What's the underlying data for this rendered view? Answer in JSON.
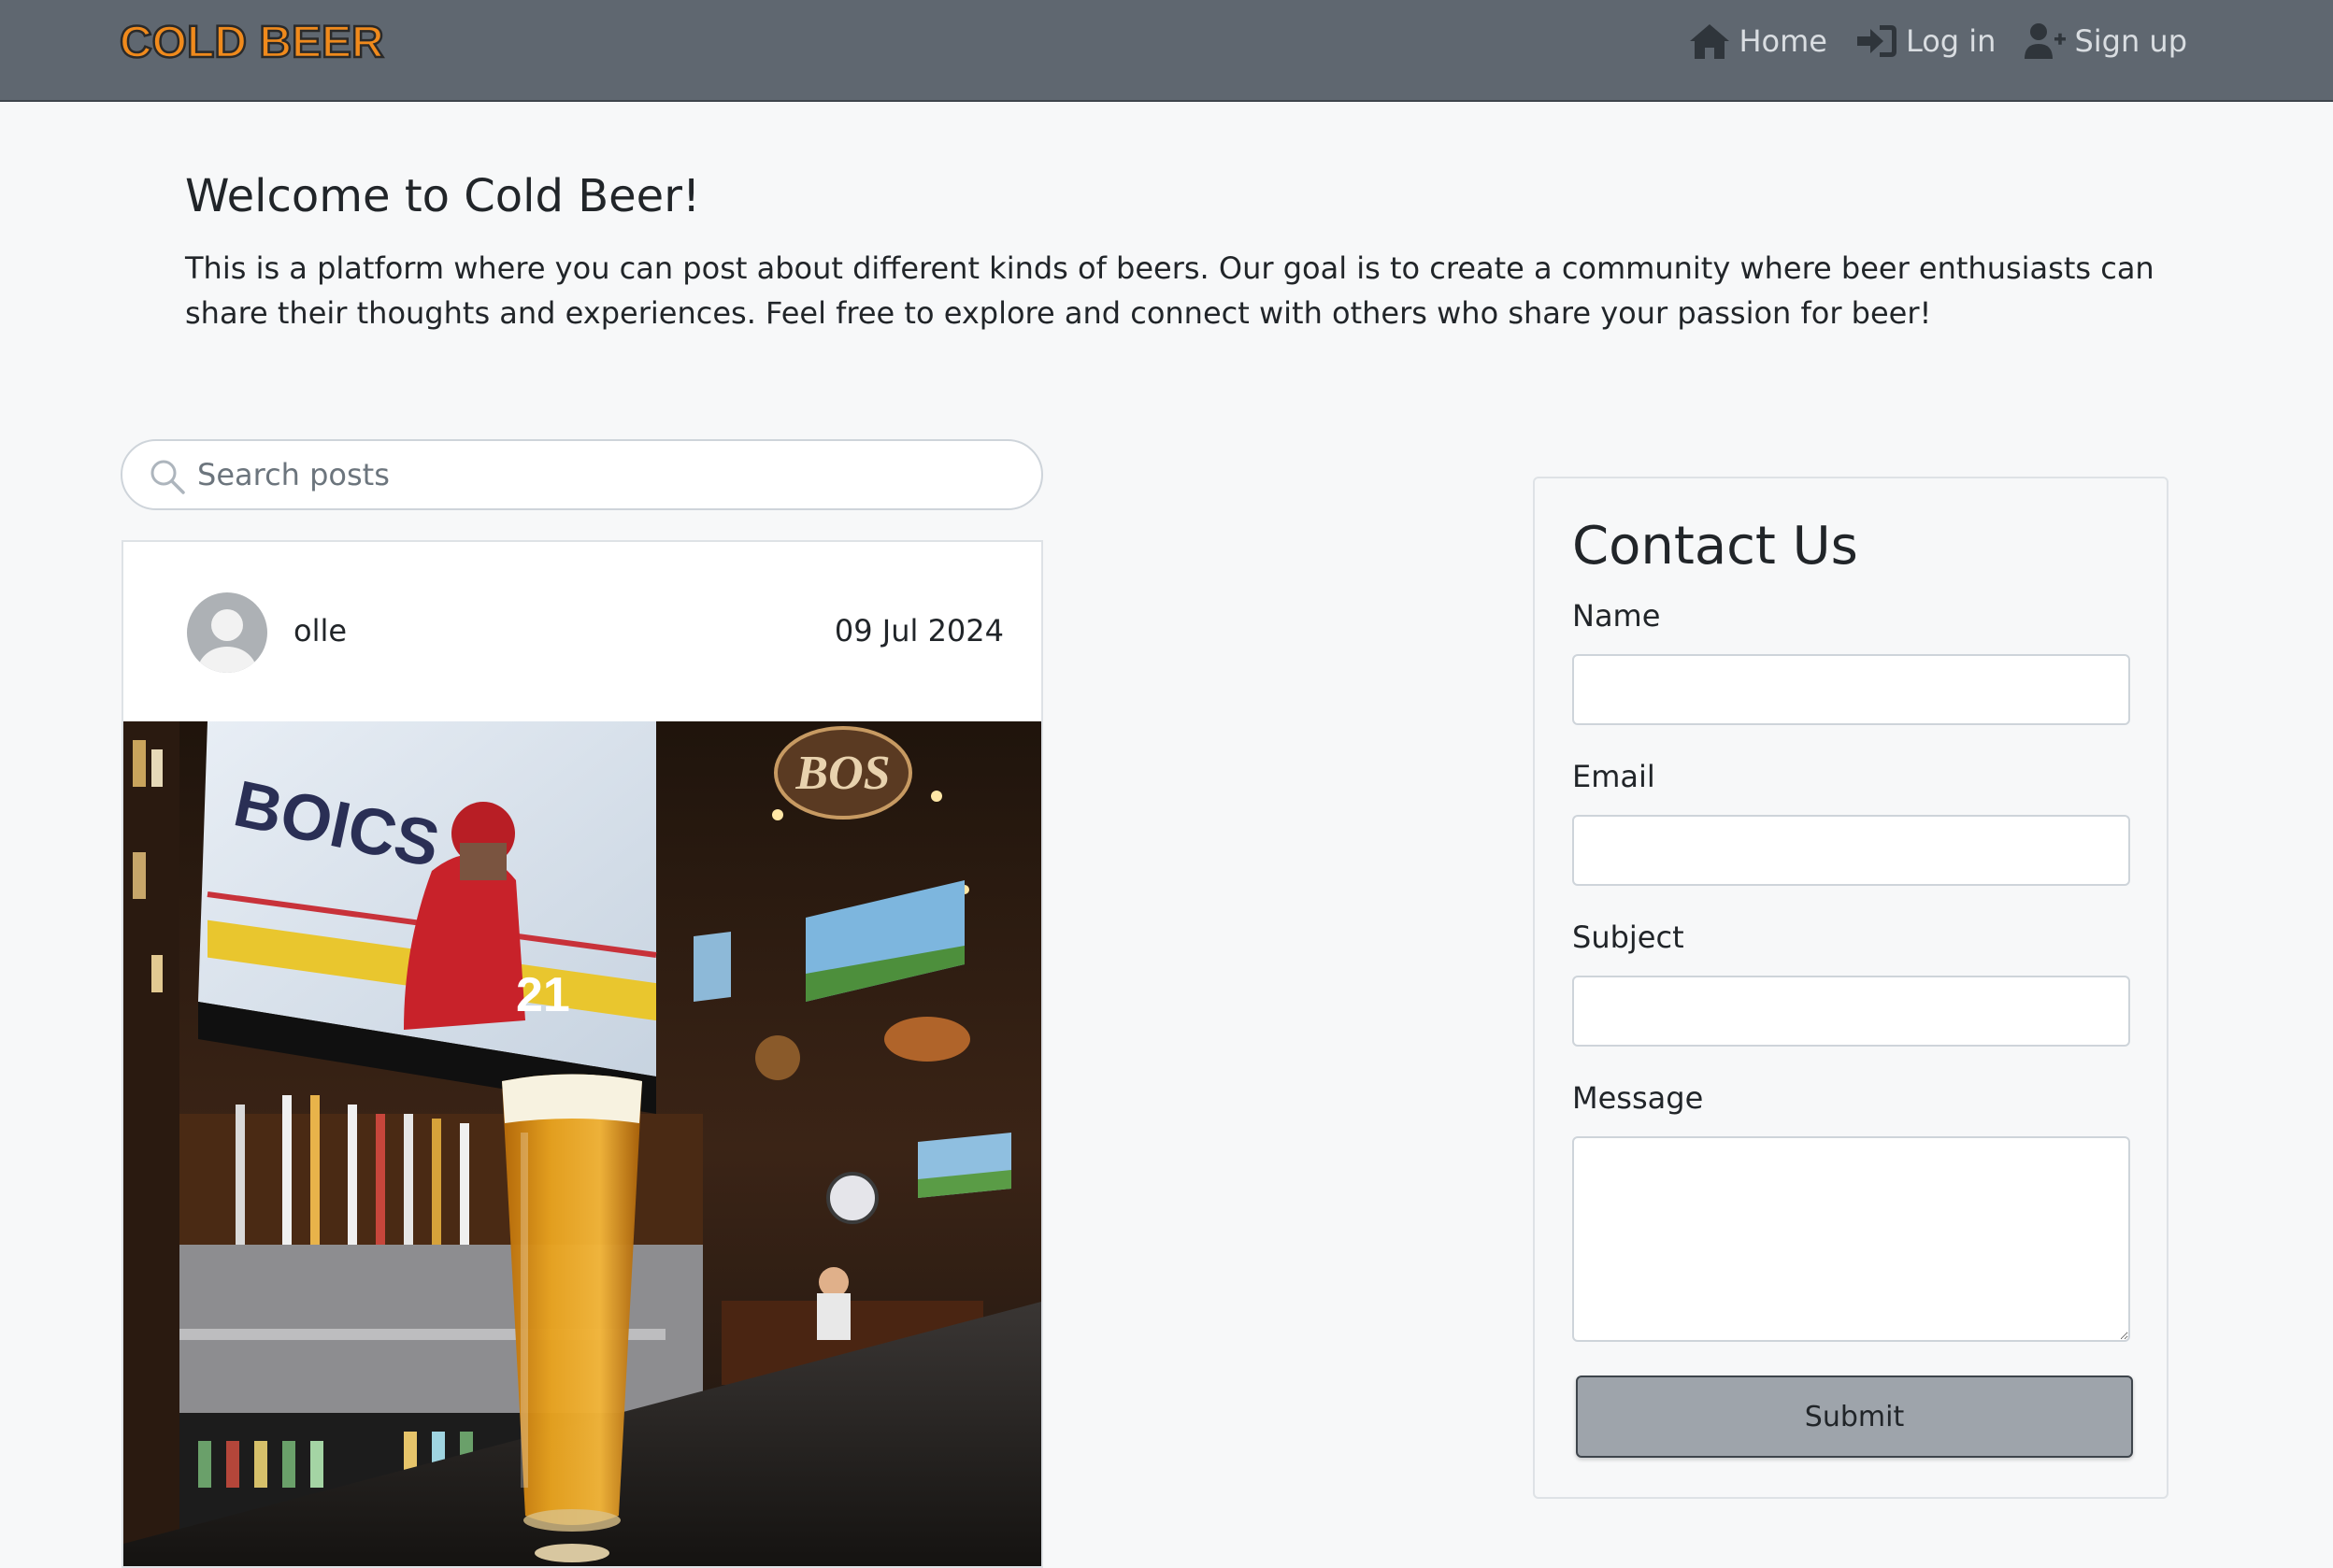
{
  "navbar": {
    "brand": "COLD BEER",
    "links": [
      {
        "label": "Home",
        "icon": "home-icon"
      },
      {
        "label": "Log in",
        "icon": "sign-in-icon"
      },
      {
        "label": "Sign up",
        "icon": "user-plus-icon"
      }
    ]
  },
  "welcome": {
    "title": "Welcome to Cold Beer!",
    "text": "This is a platform where you can post about different kinds of beers. Our goal is to create a community where beer enthusiasts can share their thoughts and experiences. Feel free to explore and connect with others who share your passion for beer!"
  },
  "search": {
    "placeholder": "Search posts",
    "value": ""
  },
  "post": {
    "username": "olle",
    "date": "09 Jul 2024",
    "image_alt": "Glass of beer on a bar counter in a sports bar"
  },
  "contact": {
    "title": "Contact Us",
    "fields": {
      "name_label": "Name",
      "email_label": "Email",
      "subject_label": "Subject",
      "message_label": "Message"
    },
    "submit_label": "Submit"
  },
  "colors": {
    "navbar_bg": "#5f6770",
    "brand": "#f08a1c",
    "page_bg": "#f7f8f9",
    "submit_bg": "#9ea4ab"
  }
}
